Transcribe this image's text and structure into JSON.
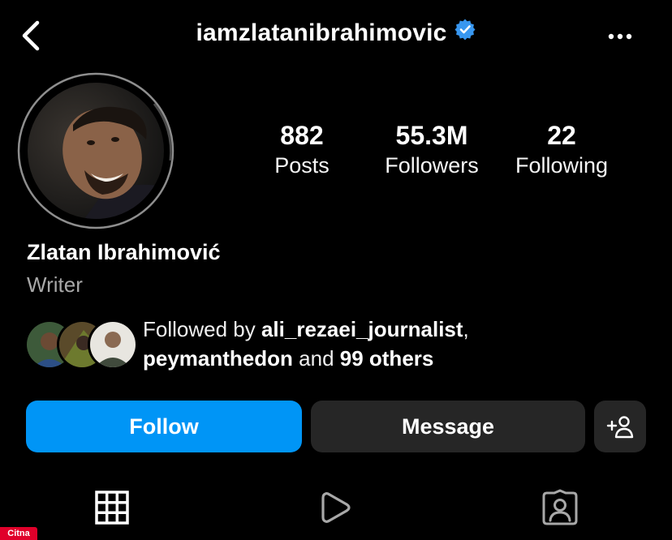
{
  "header": {
    "username": "iamzlatanibrahimovic",
    "back_icon": "chevron-left-icon",
    "verified_icon": "verified-badge-icon",
    "more_icon": "more-horizontal-icon"
  },
  "profile": {
    "full_name": "Zlatan Ibrahimović",
    "category": "Writer",
    "stats": [
      {
        "value": "882",
        "label": "Posts"
      },
      {
        "value": "55.3M",
        "label": "Followers"
      },
      {
        "value": "22",
        "label": "Following"
      }
    ]
  },
  "followed_by": {
    "prefix": "Followed by ",
    "user1": "ali_rezaei_journalist",
    "separator": ",",
    "user2": "peymanthedon",
    "conj": " and ",
    "others": "99 others"
  },
  "actions": {
    "follow_label": "Follow",
    "message_label": "Message",
    "suggest_icon": "add-person-icon"
  },
  "tabs": [
    {
      "icon": "grid-icon"
    },
    {
      "icon": "reels-icon"
    },
    {
      "icon": "tagged-icon"
    }
  ],
  "watermark": "Citna",
  "colors": {
    "accent": "#0095f6",
    "verified": "#3897f0",
    "button_dark": "#262626",
    "muted_text": "#a8a8a8"
  }
}
